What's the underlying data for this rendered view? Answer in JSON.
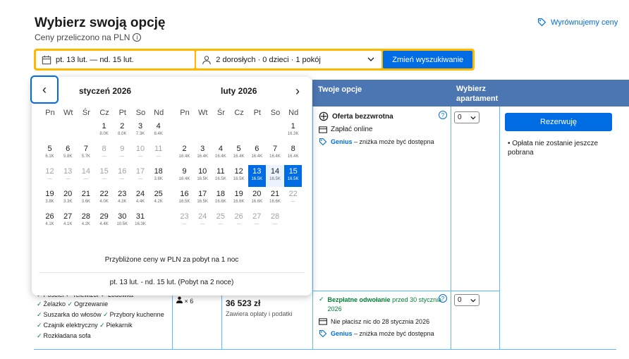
{
  "header": {
    "title": "Wybierz swoją opcję",
    "subtitle": "Ceny przeliczono na PLN",
    "price_match": "Wyrównujemy ceny"
  },
  "search": {
    "dates": "pt. 13 lut. — nd. 15 lut.",
    "guests": "2 dorosłych · 0 dzieci · 1 pokój",
    "button": "Zmień wyszukiwanie"
  },
  "table": {
    "col_options": "Twoje opcje",
    "col_select_line1": "Wybierz",
    "col_select_line2": "apartament"
  },
  "option1": {
    "title": "Oferta bezzwrotna",
    "pay": "Zapłać online",
    "genius": "Genius",
    "genius_rest": " – zniżka może być dostępna",
    "select_value": "0"
  },
  "reserve": {
    "button": "Rezerwuję",
    "note": "Opłata nie zostanie jeszcze pobrana"
  },
  "option2": {
    "cancel_bold": "Bezpłatne odwołanie",
    "cancel_rest": " przed 30 stycznia 2026",
    "pay_later": "Nie płacisz nic do 28 stycznia 2026",
    "genius": "Genius",
    "genius_rest": " – zniżka może być dostępna",
    "select_value": "0"
  },
  "amenities": {
    "row0": "Pościel  ✓ Telewizor  ✓ Lodówka",
    "row1a": "Żelazko",
    "row1b": "Ogrzewanie",
    "row2a": "Suszarka do włosów",
    "row2b": "Przybory kuchenne",
    "row3a": "Czajnik elektryczny",
    "row3b": "Piekarnik",
    "row4": "Rozkładana sofa"
  },
  "guests_cell": "× 6",
  "price": {
    "value": "36 523 zł",
    "sub": "Zawiera opłaty i podatki"
  },
  "calendar": {
    "prev": "‹",
    "next": "›",
    "month1": "styczeń 2026",
    "month2": "luty 2026",
    "weekdays": [
      "Pn",
      "Wt",
      "Śr",
      "Cz",
      "Pt",
      "So",
      "Nd"
    ],
    "note": "Przybliżone ceny w PLN za pobyt na 1 noc",
    "range": "pt. 13 lut. - nd. 15 lut. (Pobyt na 2 noce)",
    "jan": [
      {
        "col": 3,
        "row": 0,
        "n": "1",
        "p": "8.0K"
      },
      {
        "col": 4,
        "row": 0,
        "n": "2",
        "p": "8.0K"
      },
      {
        "col": 5,
        "row": 0,
        "n": "3",
        "p": "7.3K"
      },
      {
        "col": 6,
        "row": 0,
        "n": "4",
        "p": "6.4K"
      },
      {
        "col": 0,
        "row": 1,
        "n": "5",
        "p": "6.1K"
      },
      {
        "col": 1,
        "row": 1,
        "n": "6",
        "p": "5.8K"
      },
      {
        "col": 2,
        "row": 1,
        "n": "7",
        "p": "5.7K"
      },
      {
        "col": 3,
        "row": 1,
        "n": "8",
        "p": "—",
        "d": true
      },
      {
        "col": 4,
        "row": 1,
        "n": "9",
        "p": "—",
        "d": true
      },
      {
        "col": 5,
        "row": 1,
        "n": "10",
        "p": "—",
        "d": true
      },
      {
        "col": 6,
        "row": 1,
        "n": "11",
        "p": "—",
        "d": true
      },
      {
        "col": 0,
        "row": 2,
        "n": "12",
        "p": "—",
        "d": true
      },
      {
        "col": 1,
        "row": 2,
        "n": "13",
        "p": "—",
        "d": true
      },
      {
        "col": 2,
        "row": 2,
        "n": "14",
        "p": "—",
        "d": true
      },
      {
        "col": 3,
        "row": 2,
        "n": "15",
        "p": "—",
        "d": true
      },
      {
        "col": 4,
        "row": 2,
        "n": "16",
        "p": "—",
        "d": true
      },
      {
        "col": 5,
        "row": 2,
        "n": "17",
        "p": "—",
        "d": true
      },
      {
        "col": 6,
        "row": 2,
        "n": "18",
        "p": "3.8K"
      },
      {
        "col": 0,
        "row": 3,
        "n": "19",
        "p": "3.8K"
      },
      {
        "col": 1,
        "row": 3,
        "n": "20",
        "p": "3.3K"
      },
      {
        "col": 2,
        "row": 3,
        "n": "21",
        "p": "3.6K"
      },
      {
        "col": 3,
        "row": 3,
        "n": "22",
        "p": "4.0K"
      },
      {
        "col": 4,
        "row": 3,
        "n": "23",
        "p": "4.3K"
      },
      {
        "col": 5,
        "row": 3,
        "n": "24",
        "p": "4.4K"
      },
      {
        "col": 6,
        "row": 3,
        "n": "25",
        "p": "4.2K"
      },
      {
        "col": 0,
        "row": 4,
        "n": "26",
        "p": "4.1K"
      },
      {
        "col": 1,
        "row": 4,
        "n": "27",
        "p": "4.1K"
      },
      {
        "col": 2,
        "row": 4,
        "n": "28",
        "p": "4.2K"
      },
      {
        "col": 3,
        "row": 4,
        "n": "29",
        "p": "4.4K"
      },
      {
        "col": 4,
        "row": 4,
        "n": "30",
        "p": "10.5K"
      },
      {
        "col": 5,
        "row": 4,
        "n": "31",
        "p": "16.3K"
      }
    ],
    "feb": [
      {
        "col": 6,
        "row": 0,
        "n": "1",
        "p": "16.3K"
      },
      {
        "col": 0,
        "row": 1,
        "n": "2",
        "p": "16.4K"
      },
      {
        "col": 1,
        "row": 1,
        "n": "3",
        "p": "16.4K"
      },
      {
        "col": 2,
        "row": 1,
        "n": "4",
        "p": "16.4K"
      },
      {
        "col": 3,
        "row": 1,
        "n": "5",
        "p": "16.4K"
      },
      {
        "col": 4,
        "row": 1,
        "n": "6",
        "p": "16.4K"
      },
      {
        "col": 5,
        "row": 1,
        "n": "7",
        "p": "16.4K"
      },
      {
        "col": 6,
        "row": 1,
        "n": "8",
        "p": "16.4K"
      },
      {
        "col": 0,
        "row": 2,
        "n": "9",
        "p": "16.4K"
      },
      {
        "col": 1,
        "row": 2,
        "n": "10",
        "p": "16.5K"
      },
      {
        "col": 2,
        "row": 2,
        "n": "11",
        "p": "16.5K"
      },
      {
        "col": 3,
        "row": 2,
        "n": "12",
        "p": "16.5K"
      },
      {
        "col": 4,
        "row": 2,
        "n": "13",
        "p": "16.5K",
        "s": "edge"
      },
      {
        "col": 5,
        "row": 2,
        "n": "14",
        "p": "16.5K",
        "s": "mid"
      },
      {
        "col": 6,
        "row": 2,
        "n": "15",
        "p": "16.5K",
        "s": "edge"
      },
      {
        "col": 0,
        "row": 3,
        "n": "16",
        "p": "16.5K"
      },
      {
        "col": 1,
        "row": 3,
        "n": "17",
        "p": "16.5K"
      },
      {
        "col": 2,
        "row": 3,
        "n": "18",
        "p": "16.6K"
      },
      {
        "col": 3,
        "row": 3,
        "n": "19",
        "p": "16.6K"
      },
      {
        "col": 4,
        "row": 3,
        "n": "20",
        "p": "16.6K"
      },
      {
        "col": 5,
        "row": 3,
        "n": "21",
        "p": "16.6K"
      },
      {
        "col": 6,
        "row": 3,
        "n": "22",
        "p": "—",
        "d": true
      },
      {
        "col": 0,
        "row": 4,
        "n": "23",
        "p": "—",
        "d": true
      },
      {
        "col": 1,
        "row": 4,
        "n": "24",
        "p": "—",
        "d": true
      },
      {
        "col": 2,
        "row": 4,
        "n": "25",
        "p": "—",
        "d": true
      },
      {
        "col": 3,
        "row": 4,
        "n": "26",
        "p": "—",
        "d": true
      },
      {
        "col": 4,
        "row": 4,
        "n": "27",
        "p": "—",
        "d": true
      },
      {
        "col": 5,
        "row": 4,
        "n": "28",
        "p": "—",
        "d": true
      }
    ]
  },
  "colors": {
    "brand_blue": "#006ce4",
    "header_blue": "#4c76b2",
    "search_yellow": "#ffb700",
    "success_green": "#008234"
  }
}
